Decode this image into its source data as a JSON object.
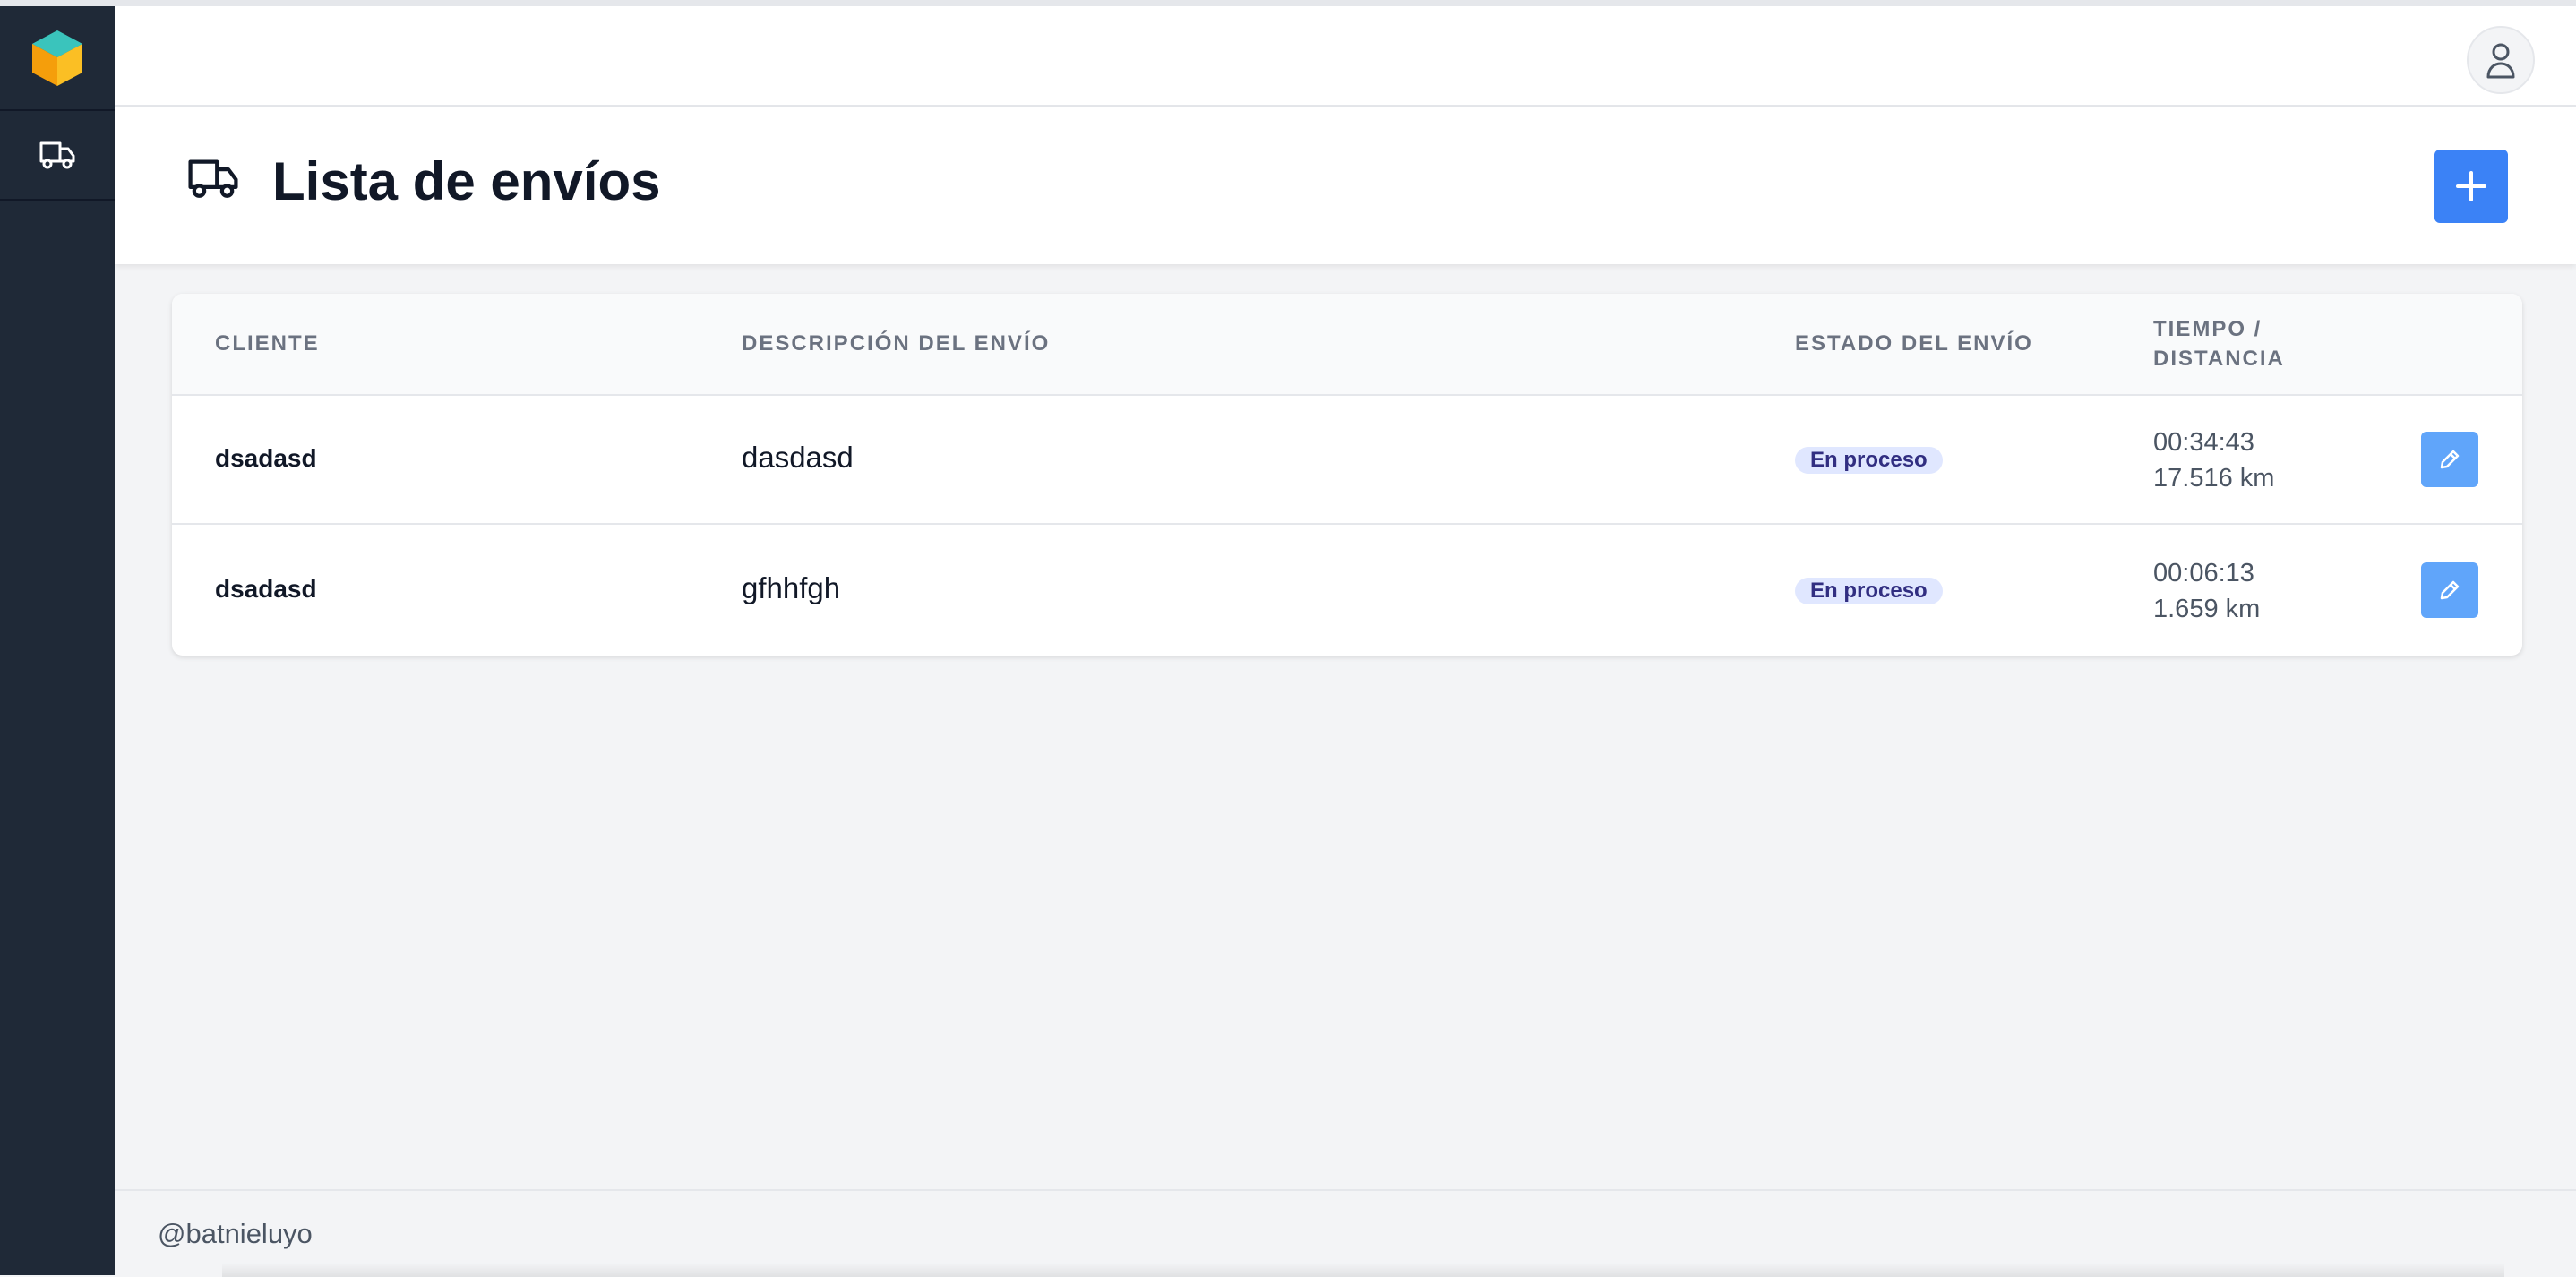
{
  "header": {
    "title": "Lista de envíos",
    "add_label": "+"
  },
  "table": {
    "columns": [
      "CLIENTE",
      "DESCRIPCIÓN DEL ENVÍO",
      "ESTADO DEL ENVÍO",
      "TIEMPO /",
      "DISTANCIA"
    ],
    "rows": [
      {
        "client": "dsadasd",
        "description": "dasdasd",
        "status": "En proceso",
        "time": "00:34:43",
        "distance": "17.516 km"
      },
      {
        "client": "dsadasd",
        "description": "gfhhfgh",
        "status": "En proceso",
        "time": "00:06:13",
        "distance": "1.659 km"
      }
    ]
  },
  "footer": {
    "text": "@batnieluyo"
  },
  "icons": {
    "logo": "cube-logo-icon",
    "sidebar_item": "truck-icon",
    "avatar": "user-icon",
    "header": "truck-icon",
    "edit": "pencil-icon"
  },
  "colors": {
    "sidebar": "#1f2937",
    "primary": "#3b82f6",
    "edit_button": "#60a5fa",
    "badge_bg": "#e0e7ff",
    "badge_text": "#312e81"
  }
}
